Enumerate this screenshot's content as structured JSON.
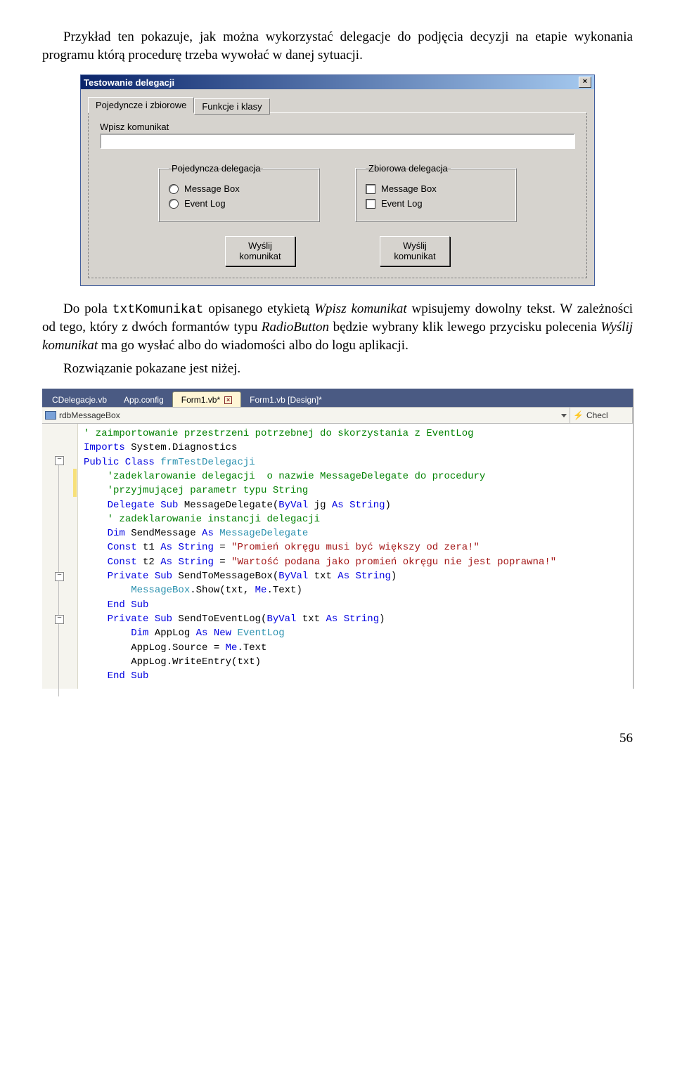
{
  "para1": "Przykład ten pokazuje, jak można wykorzystać delegacje do podjęcia decyzji na etapie wykonania programu którą procedurę trzeba wywołać w danej sytuacji.",
  "para2_pre": "Do pola ",
  "para2_code": "txtKomunikat",
  "para2_mid": " opisanego etykietą ",
  "para2_it1": "Wpisz komunikat",
  "para2_mid2": " wpisujemy dowolny tekst. W zależności od tego, który z dwóch formantów typu ",
  "para2_it2": "RadioButton",
  "para2_mid3": " będzie wybrany klik lewego przycisku polecenia ",
  "para2_it3": "Wyślij komunikat",
  "para2_end": " ma go wysłać albo do wiadomości albo do logu aplikacji.",
  "para3": "Rozwiązanie pokazane jest niżej.",
  "dialog": {
    "title": "Testowanie delegacji",
    "tab1": "Pojedyncze i zbiorowe",
    "tab2": "Funkcje i klasy",
    "input_label": "Wpisz komunikat",
    "group1": {
      "legend": "Pojedyncza delegacja",
      "opt1": "Message Box",
      "opt2": "Event Log"
    },
    "group2": {
      "legend": "Zbiorowa delegacja",
      "opt1": "Message Box",
      "opt2": "Event Log"
    },
    "button": "Wyślij\nkomunikat"
  },
  "vs": {
    "tabs": {
      "t1": "CDelegacje.vb",
      "t2": "App.config",
      "t3": "Form1.vb*",
      "t4": "Form1.vb [Design]*"
    },
    "drop1": "rdbMessageBox",
    "drop2": "Checl",
    "code": {
      "l1": "' zaimportowanie przestrzeni potrzebnej do skorzystania z EventLog",
      "l2a": "Imports",
      "l2b": " System.Diagnostics",
      "l3a": "Public Class",
      "l3b": " frmTestDelegacji",
      "l4": "'zadeklarowanie delegacji  o nazwie MessageDelegate do procedury",
      "l5": "'przyjmującej parametr typu String",
      "l6a": "Delegate Sub",
      "l6b": " MessageDelegate(",
      "l6c": "ByVal",
      "l6d": " jg ",
      "l6e": "As String",
      "l6f": ")",
      "l7": "' zadeklarowanie instancji delegacji",
      "l8a": "Dim",
      "l8b": " SendMessage ",
      "l8c": "As",
      "l8d": " MessageDelegate",
      "l9a": "Const",
      "l9b": " t1 ",
      "l9c": "As String",
      "l9d": " = ",
      "l9e": "\"Promień okręgu musi być większy od zera!\"",
      "l10a": "Const",
      "l10b": " t2 ",
      "l10c": "As String",
      "l10d": " = ",
      "l10e": "\"Wartość podana jako promień okręgu nie jest poprawna!\"",
      "l11a": "Private Sub",
      "l11b": " SendToMessageBox(",
      "l11c": "ByVal",
      "l11d": " txt ",
      "l11e": "As String",
      "l11f": ")",
      "l12a": "MessageBox",
      "l12b": ".Show(txt, ",
      "l12c": "Me",
      "l12d": ".Text)",
      "l13": "End Sub",
      "l14a": "Private Sub",
      "l14b": " SendToEventLog(",
      "l14c": "ByVal",
      "l14d": " txt ",
      "l14e": "As String",
      "l14f": ")",
      "l15a": "Dim",
      "l15b": " AppLog ",
      "l15c": "As New",
      "l15d": " EventLog",
      "l16": "AppLog.Source = ",
      "l16b": "Me",
      "l16c": ".Text",
      "l17": "AppLog.WriteEntry(txt)",
      "l18": "End Sub"
    }
  },
  "page": "56"
}
